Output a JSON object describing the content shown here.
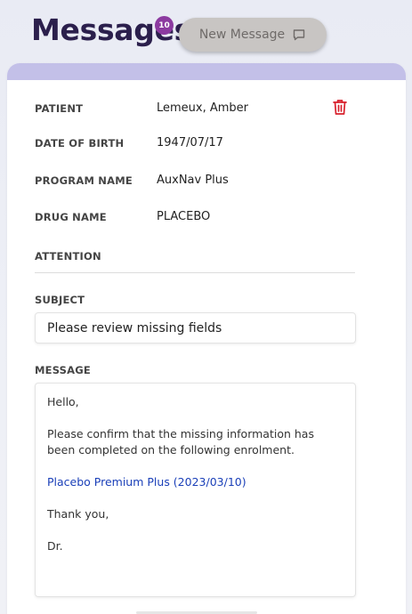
{
  "header": {
    "title": "Messages",
    "badge_count": "10",
    "new_message_label": "New Message"
  },
  "patient_info": {
    "patient_label": "PATIENT",
    "patient_value": "Lemeux, Amber",
    "dob_label": "DATE OF BIRTH",
    "dob_value": "1947/07/17",
    "program_label": "PROGRAM NAME",
    "program_value": "AuxNav Plus",
    "drug_label": "DRUG NAME",
    "drug_value": "PLACEBO",
    "attention_label": "ATTENTION"
  },
  "subject": {
    "label": "SUBJECT",
    "value": "Please review missing fields"
  },
  "message": {
    "label": "MESSAGE",
    "greeting": "Hello,",
    "body": "Please confirm that the missing information has been completed on the following enrolment.",
    "link": "Placebo Premium Plus (2023/03/10)",
    "thanks": "Thank you,",
    "signature": "Dr."
  },
  "colors": {
    "title": "#2b1f4c",
    "badge": "#8c3aa0",
    "card_top": "#c3c0e8",
    "trash": "#d8202c",
    "link": "#1a3fb8"
  },
  "icons": [
    "chat-bubble-icon",
    "trash-icon"
  ]
}
